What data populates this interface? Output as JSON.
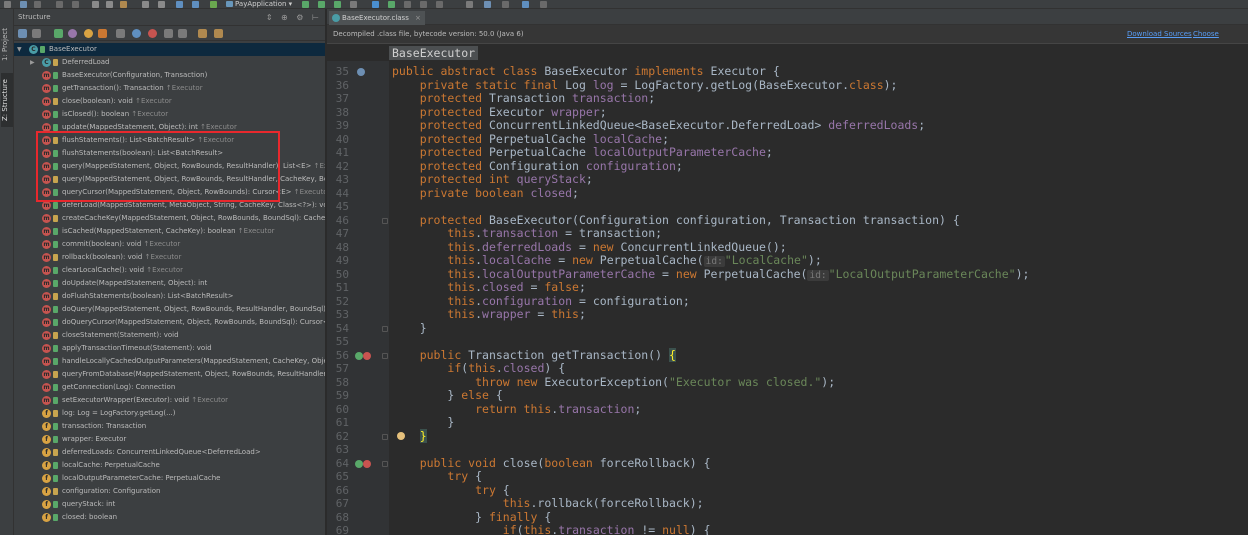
{
  "toolbar": {
    "run_configuration": "PayApplication"
  },
  "left_stripe": {
    "project_tab": "1: Project",
    "structure_tab": "Z: Structure"
  },
  "structure_panel": {
    "title": "Structure",
    "header_icons": "⇕ ⊕ ⚙ ⊢",
    "root": "BaseExecutor",
    "items": [
      {
        "text": "DeferredLoad",
        "suffix": "",
        "icon": "class-icon",
        "color": "#4a9ca6",
        "expanded": false
      },
      {
        "text": "BaseExecutor(Configuration, Transaction)",
        "suffix": "",
        "icon": "method-icon",
        "color": "#c75450"
      },
      {
        "text": "getTransaction(): Transaction",
        "suffix": "↑Executor",
        "icon": "method-icon",
        "color": "#c75450"
      },
      {
        "text": "close(boolean): void",
        "suffix": "↑Executor",
        "icon": "method-icon",
        "color": "#c75450"
      },
      {
        "text": "isClosed(): boolean",
        "suffix": "↑Executor",
        "icon": "method-icon",
        "color": "#c75450"
      },
      {
        "text": "update(MappedStatement, Object): int",
        "suffix": "↑Executor",
        "icon": "method-icon",
        "color": "#c75450"
      },
      {
        "text": "flushStatements(): List<BatchResult>",
        "suffix": "↑Executor",
        "icon": "method-icon",
        "color": "#c75450"
      },
      {
        "text": "flushStatements(boolean): List<BatchResult>",
        "suffix": "",
        "icon": "method-icon",
        "color": "#c75450"
      },
      {
        "text": "query(MappedStatement, Object, RowBounds, ResultHandler): List<E>",
        "suffix": "↑Executor",
        "icon": "method-icon",
        "color": "#c75450"
      },
      {
        "text": "query(MappedStatement, Object, RowBounds, ResultHandler, CacheKey, BoundSql): List<E>",
        "suffix": "",
        "icon": "method-icon",
        "color": "#c75450"
      },
      {
        "text": "queryCursor(MappedStatement, Object, RowBounds): Cursor<E>",
        "suffix": "↑Executor",
        "icon": "method-icon",
        "color": "#c75450"
      },
      {
        "text": "deferLoad(MappedStatement, MetaObject, String, CacheKey, Class<?>): void",
        "suffix": "↑Executor",
        "icon": "method-icon",
        "color": "#c75450"
      },
      {
        "text": "createCacheKey(MappedStatement, Object, RowBounds, BoundSql): CacheKey",
        "suffix": "↑Executor",
        "icon": "method-icon",
        "color": "#c75450"
      },
      {
        "text": "isCached(MappedStatement, CacheKey): boolean",
        "suffix": "↑Executor",
        "icon": "method-icon",
        "color": "#c75450"
      },
      {
        "text": "commit(boolean): void",
        "suffix": "↑Executor",
        "icon": "method-icon",
        "color": "#c75450"
      },
      {
        "text": "rollback(boolean): void",
        "suffix": "↑Executor",
        "icon": "method-icon",
        "color": "#c75450"
      },
      {
        "text": "clearLocalCache(): void",
        "suffix": "↑Executor",
        "icon": "method-icon",
        "color": "#c75450"
      },
      {
        "text": "doUpdate(MappedStatement, Object): int",
        "suffix": "",
        "icon": "method-icon",
        "color": "#c75450"
      },
      {
        "text": "doFlushStatements(boolean): List<BatchResult>",
        "suffix": "",
        "icon": "method-icon",
        "color": "#c75450"
      },
      {
        "text": "doQuery(MappedStatement, Object, RowBounds, ResultHandler, BoundSql): List<E>",
        "suffix": "",
        "icon": "method-icon",
        "color": "#c75450"
      },
      {
        "text": "doQueryCursor(MappedStatement, Object, RowBounds, BoundSql): Cursor<E>",
        "suffix": "",
        "icon": "method-icon",
        "color": "#c75450"
      },
      {
        "text": "closeStatement(Statement): void",
        "suffix": "",
        "icon": "method-icon",
        "color": "#c75450"
      },
      {
        "text": "applyTransactionTimeout(Statement): void",
        "suffix": "",
        "icon": "method-icon",
        "color": "#c75450"
      },
      {
        "text": "handleLocallyCachedOutputParameters(MappedStatement, CacheKey, Object, BoundSql): void",
        "suffix": "",
        "icon": "method-icon",
        "color": "#c75450"
      },
      {
        "text": "queryFromDatabase(MappedStatement, Object, RowBounds, ResultHandler, CacheKey, BoundSql): List<E>",
        "suffix": "",
        "icon": "method-icon",
        "color": "#c75450"
      },
      {
        "text": "getConnection(Log): Connection",
        "suffix": "",
        "icon": "method-icon",
        "color": "#c75450"
      },
      {
        "text": "setExecutorWrapper(Executor): void",
        "suffix": "↑Executor",
        "icon": "method-icon",
        "color": "#c75450"
      },
      {
        "text": "log: Log = LogFactory.getLog(...)",
        "suffix": "",
        "icon": "field-icon",
        "color": "#d9a343"
      },
      {
        "text": "transaction: Transaction",
        "suffix": "",
        "icon": "field-icon",
        "color": "#d9a343"
      },
      {
        "text": "wrapper: Executor",
        "suffix": "",
        "icon": "field-icon",
        "color": "#d9a343"
      },
      {
        "text": "deferredLoads: ConcurrentLinkedQueue<DeferredLoad>",
        "suffix": "",
        "icon": "field-icon",
        "color": "#d9a343"
      },
      {
        "text": "localCache: PerpetualCache",
        "suffix": "",
        "icon": "field-icon",
        "color": "#d9a343"
      },
      {
        "text": "localOutputParameterCache: PerpetualCache",
        "suffix": "",
        "icon": "field-icon",
        "color": "#d9a343"
      },
      {
        "text": "configuration: Configuration",
        "suffix": "",
        "icon": "field-icon",
        "color": "#d9a343"
      },
      {
        "text": "queryStack: int",
        "suffix": "",
        "icon": "field-icon",
        "color": "#d9a343"
      },
      {
        "text": "closed: boolean",
        "suffix": "",
        "icon": "field-icon",
        "color": "#d9a343"
      }
    ]
  },
  "editor": {
    "tab_label": "BaseExecutor.class",
    "notice": "Decompiled .class file, bytecode version: 50.0 (Java 6)",
    "download_sources": "Download Sources",
    "choose_sources": "Choose Sources",
    "breadcrumb": "BaseExecutor",
    "lines": [
      {
        "n": "35",
        "t": [
          [
            "k",
            "public abstract class "
          ],
          [
            "p",
            "BaseExecutor "
          ],
          [
            "k",
            "implements "
          ],
          [
            "p",
            "Executor {"
          ]
        ]
      },
      {
        "n": "36",
        "t": [
          [
            "p",
            "    "
          ],
          [
            "k",
            "private static final "
          ],
          [
            "p",
            "Log "
          ],
          [
            "f",
            "log"
          ],
          [
            "p",
            " = LogFactory.getLog(BaseExecutor."
          ],
          [
            "k",
            "class"
          ],
          [
            "p",
            ");"
          ]
        ]
      },
      {
        "n": "37",
        "t": [
          [
            "p",
            "    "
          ],
          [
            "k",
            "protected "
          ],
          [
            "p",
            "Transaction "
          ],
          [
            "f",
            "transaction"
          ],
          [
            "p",
            ";"
          ]
        ]
      },
      {
        "n": "38",
        "t": [
          [
            "p",
            "    "
          ],
          [
            "k",
            "protected "
          ],
          [
            "p",
            "Executor "
          ],
          [
            "f",
            "wrapper"
          ],
          [
            "p",
            ";"
          ]
        ]
      },
      {
        "n": "39",
        "t": [
          [
            "p",
            "    "
          ],
          [
            "k",
            "protected "
          ],
          [
            "p",
            "ConcurrentLinkedQueue<BaseExecutor.DeferredLoad> "
          ],
          [
            "f",
            "deferredLoads"
          ],
          [
            "p",
            ";"
          ]
        ]
      },
      {
        "n": "40",
        "t": [
          [
            "p",
            "    "
          ],
          [
            "k",
            "protected "
          ],
          [
            "p",
            "PerpetualCache "
          ],
          [
            "f",
            "localCache"
          ],
          [
            "p",
            ";"
          ]
        ]
      },
      {
        "n": "41",
        "t": [
          [
            "p",
            "    "
          ],
          [
            "k",
            "protected "
          ],
          [
            "p",
            "PerpetualCache "
          ],
          [
            "f",
            "localOutputParameterCache"
          ],
          [
            "p",
            ";"
          ]
        ]
      },
      {
        "n": "42",
        "t": [
          [
            "p",
            "    "
          ],
          [
            "k",
            "protected "
          ],
          [
            "p",
            "Configuration "
          ],
          [
            "f",
            "configuration"
          ],
          [
            "p",
            ";"
          ]
        ]
      },
      {
        "n": "43",
        "t": [
          [
            "p",
            "    "
          ],
          [
            "k",
            "protected int "
          ],
          [
            "f",
            "queryStack"
          ],
          [
            "p",
            ";"
          ]
        ]
      },
      {
        "n": "44",
        "t": [
          [
            "p",
            "    "
          ],
          [
            "k",
            "private boolean "
          ],
          [
            "f",
            "closed"
          ],
          [
            "p",
            ";"
          ]
        ]
      },
      {
        "n": "45",
        "t": []
      },
      {
        "n": "46",
        "t": [
          [
            "p",
            "    "
          ],
          [
            "k",
            "protected "
          ],
          [
            "p",
            "BaseExecutor(Configuration configuration, Transaction transaction) {"
          ]
        ]
      },
      {
        "n": "47",
        "t": [
          [
            "p",
            "        "
          ],
          [
            "k",
            "this"
          ],
          [
            "p",
            "."
          ],
          [
            "f",
            "transaction"
          ],
          [
            "p",
            " = transaction;"
          ]
        ]
      },
      {
        "n": "48",
        "t": [
          [
            "p",
            "        "
          ],
          [
            "k",
            "this"
          ],
          [
            "p",
            "."
          ],
          [
            "f",
            "deferredLoads"
          ],
          [
            "p",
            " = "
          ],
          [
            "k",
            "new "
          ],
          [
            "p",
            "ConcurrentLinkedQueue();"
          ]
        ]
      },
      {
        "n": "49",
        "t": [
          [
            "p",
            "        "
          ],
          [
            "k",
            "this"
          ],
          [
            "p",
            "."
          ],
          [
            "f",
            "localCache"
          ],
          [
            "p",
            " = "
          ],
          [
            "k",
            "new "
          ],
          [
            "p",
            "PerpetualCache("
          ],
          [
            "h",
            "id:"
          ],
          [
            "s",
            "\"LocalCache\""
          ],
          [
            "p",
            ");"
          ]
        ]
      },
      {
        "n": "50",
        "t": [
          [
            "p",
            "        "
          ],
          [
            "k",
            "this"
          ],
          [
            "p",
            "."
          ],
          [
            "f",
            "localOutputParameterCache"
          ],
          [
            "p",
            " = "
          ],
          [
            "k",
            "new "
          ],
          [
            "p",
            "PerpetualCache("
          ],
          [
            "h",
            "id:"
          ],
          [
            "s",
            "\"LocalOutputParameterCache\""
          ],
          [
            "p",
            ");"
          ]
        ]
      },
      {
        "n": "51",
        "t": [
          [
            "p",
            "        "
          ],
          [
            "k",
            "this"
          ],
          [
            "p",
            "."
          ],
          [
            "f",
            "closed"
          ],
          [
            "p",
            " = "
          ],
          [
            "k",
            "false"
          ],
          [
            "p",
            ";"
          ]
        ]
      },
      {
        "n": "52",
        "t": [
          [
            "p",
            "        "
          ],
          [
            "k",
            "this"
          ],
          [
            "p",
            "."
          ],
          [
            "f",
            "configuration"
          ],
          [
            "p",
            " = configuration;"
          ]
        ]
      },
      {
        "n": "53",
        "t": [
          [
            "p",
            "        "
          ],
          [
            "k",
            "this"
          ],
          [
            "p",
            "."
          ],
          [
            "f",
            "wrapper"
          ],
          [
            "p",
            " = "
          ],
          [
            "k",
            "this"
          ],
          [
            "p",
            ";"
          ]
        ]
      },
      {
        "n": "54",
        "t": [
          [
            "p",
            "    }"
          ]
        ]
      },
      {
        "n": "55",
        "t": []
      },
      {
        "n": "56",
        "t": [
          [
            "p",
            "    "
          ],
          [
            "k",
            "public "
          ],
          [
            "p",
            "Transaction getTransaction() "
          ],
          [
            "b",
            "{"
          ]
        ]
      },
      {
        "n": "57",
        "t": [
          [
            "p",
            "        "
          ],
          [
            "k",
            "if"
          ],
          [
            "p",
            "("
          ],
          [
            "k",
            "this"
          ],
          [
            "p",
            "."
          ],
          [
            "f",
            "closed"
          ],
          [
            "p",
            ") {"
          ]
        ]
      },
      {
        "n": "58",
        "t": [
          [
            "p",
            "            "
          ],
          [
            "k",
            "throw new "
          ],
          [
            "p",
            "ExecutorException("
          ],
          [
            "s",
            "\"Executor was closed.\""
          ],
          [
            "p",
            ");"
          ]
        ]
      },
      {
        "n": "59",
        "t": [
          [
            "p",
            "        } "
          ],
          [
            "k",
            "else "
          ],
          [
            "p",
            "{"
          ]
        ]
      },
      {
        "n": "60",
        "t": [
          [
            "p",
            "            "
          ],
          [
            "k",
            "return this"
          ],
          [
            "p",
            "."
          ],
          [
            "f",
            "transaction"
          ],
          [
            "p",
            ";"
          ]
        ]
      },
      {
        "n": "61",
        "t": [
          [
            "p",
            "        }"
          ]
        ]
      },
      {
        "n": "62",
        "t": [
          [
            "p",
            "    "
          ],
          [
            "b",
            "}"
          ]
        ]
      },
      {
        "n": "63",
        "t": []
      },
      {
        "n": "64",
        "t": [
          [
            "p",
            "    "
          ],
          [
            "k",
            "public void "
          ],
          [
            "p",
            "close("
          ],
          [
            "k",
            "boolean "
          ],
          [
            "p",
            "forceRollback) {"
          ]
        ]
      },
      {
        "n": "65",
        "t": [
          [
            "p",
            "        "
          ],
          [
            "k",
            "try "
          ],
          [
            "p",
            "{"
          ]
        ]
      },
      {
        "n": "66",
        "t": [
          [
            "p",
            "            "
          ],
          [
            "k",
            "try "
          ],
          [
            "p",
            "{"
          ]
        ]
      },
      {
        "n": "67",
        "t": [
          [
            "p",
            "                "
          ],
          [
            "k",
            "this"
          ],
          [
            "p",
            ".rollback(forceRollback);"
          ]
        ]
      },
      {
        "n": "68",
        "t": [
          [
            "p",
            "            } "
          ],
          [
            "k",
            "finally "
          ],
          [
            "p",
            "{"
          ]
        ]
      },
      {
        "n": "69",
        "t": [
          [
            "p",
            "                "
          ],
          [
            "k",
            "if"
          ],
          [
            "p",
            "("
          ],
          [
            "k",
            "this"
          ],
          [
            "p",
            "."
          ],
          [
            "f",
            "transaction"
          ],
          [
            "p",
            " != "
          ],
          [
            "k",
            "null"
          ],
          [
            "p",
            ") {"
          ]
        ]
      }
    ]
  }
}
